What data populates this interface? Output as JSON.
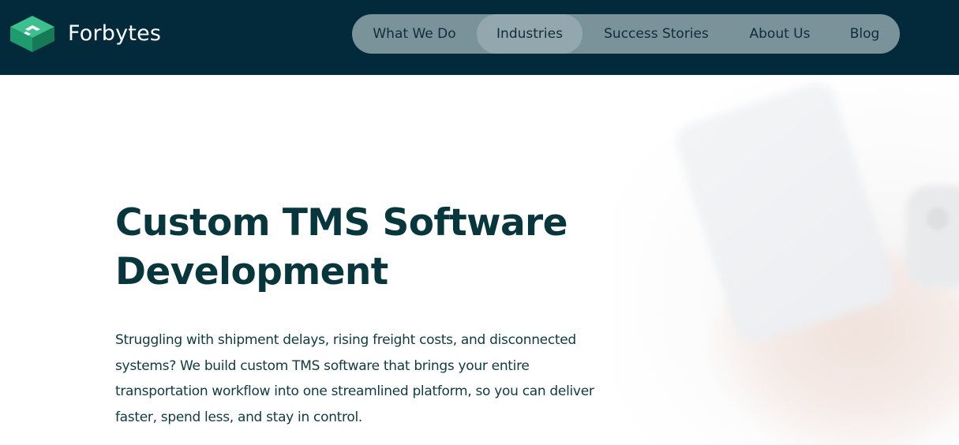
{
  "brand": {
    "name": "Forbytes",
    "logo_icon": "forbytes-cube-logo",
    "logo_colors": [
      "#3dbf8f",
      "#1e9b6f",
      "#167a57"
    ]
  },
  "colors": {
    "header_bg": "#022a3a",
    "nav_bg": "#7a939b",
    "nav_active_bg": "#93a8ae",
    "title_color": "#08363d"
  },
  "nav": {
    "items": [
      {
        "label": "What We Do"
      },
      {
        "label": "Industries",
        "active": true
      },
      {
        "label": "Success Stories"
      },
      {
        "label": "About Us"
      },
      {
        "label": "Blog"
      }
    ]
  },
  "hero": {
    "title_line1": "Custom TMS Software",
    "title_line2": "Development",
    "description": "Struggling with shipment delays, rising freight costs, and disconnected systems? We build custom TMS software that brings your entire transportation workflow into one streamlined platform, so you can deliver faster, spend less, and stay in control."
  }
}
